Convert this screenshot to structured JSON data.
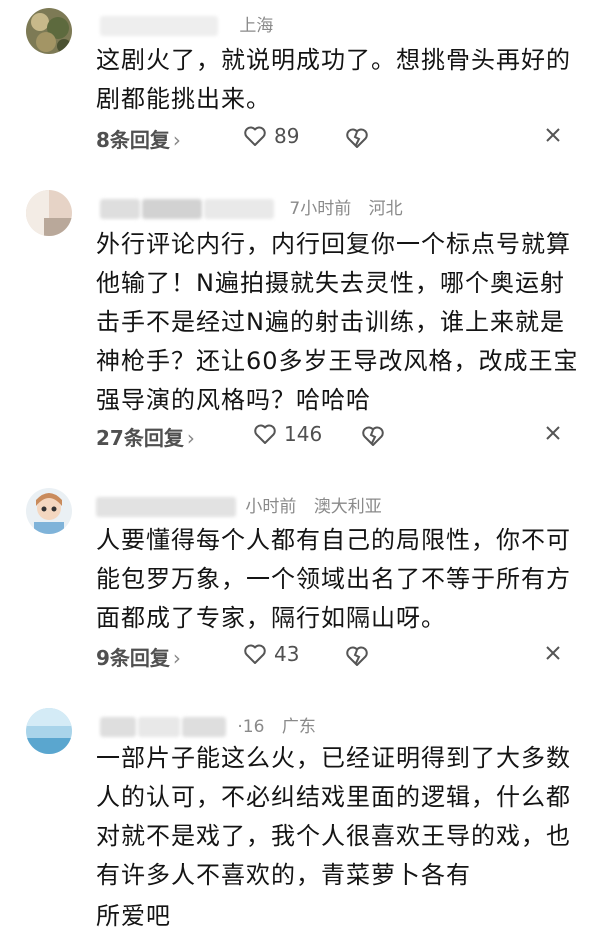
{
  "comments": [
    {
      "location": "上海",
      "time": "",
      "text": "这剧火了，就说明成功了。想挑骨头再好的剧都能挑出来。",
      "replies": "8条回复",
      "likes": "89"
    },
    {
      "location": "河北",
      "time": "7小时前",
      "text": "外行评论内行，内行回复你一个标点号就算他输了！N遍拍摄就失去灵性，哪个奥运射击手不是经过N遍的射击训练，谁上来就是神枪手？还让60多岁王导改风格，改成王宝强导演的风格吗？哈哈哈",
      "replies": "27条回复",
      "likes": "146"
    },
    {
      "location": "澳大利亚",
      "time": "小时前",
      "text": "人要懂得每个人都有自己的局限性，你不可能包罗万象，一个领域出名了不等于所有方面都成了专家，隔行如隔山呀。",
      "replies": "9条回复",
      "likes": "43"
    },
    {
      "location": "广东",
      "time": "·16",
      "text": "一部片子能这么火，已经证明得到了大多数人的认可，不必纠结戏里面的逻辑，什么都对就不是戏了，我个人很喜欢王导的戏，也有许多人不喜欢的，青菜萝卜各有",
      "overflow": "所爱吧",
      "replies": "",
      "likes": ""
    }
  ],
  "colors": {
    "text": "#141414",
    "meta": "#8a8a8a",
    "action": "#505050"
  },
  "icons": {
    "chevron": "›",
    "heart": "heart-icon",
    "broken": "broken-heart-icon",
    "close": "close-icon"
  }
}
